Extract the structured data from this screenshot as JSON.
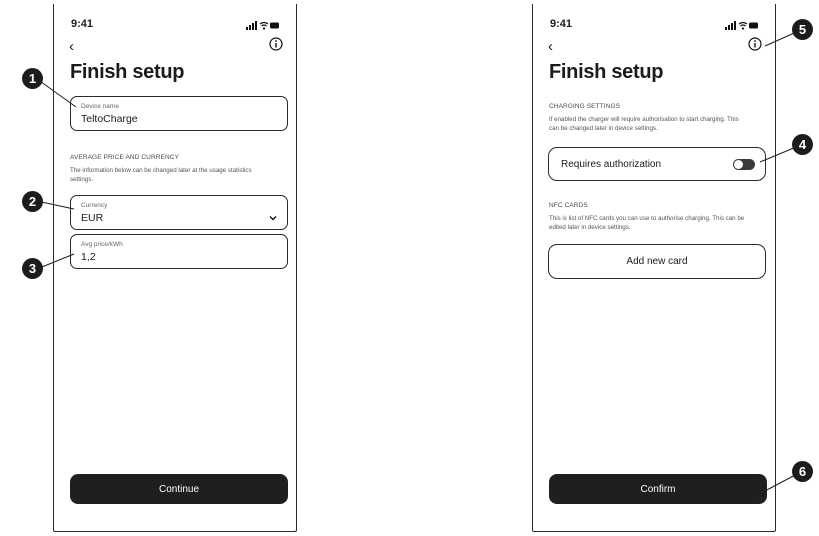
{
  "status": {
    "time": "9:41"
  },
  "screen1": {
    "title": "Finish setup",
    "device_name": {
      "label": "Device name",
      "value": "TeltoCharge"
    },
    "price_section": {
      "heading": "AVERAGE PRICE AND CURRENCY",
      "description": "The information below can be changed later at the usage statistics settings."
    },
    "currency": {
      "label": "Currency",
      "value": "EUR"
    },
    "avg_price": {
      "label": "Avg price/kWh",
      "value": "1,2"
    },
    "continue_label": "Continue"
  },
  "screen2": {
    "title": "Finish setup",
    "charging_section": {
      "heading": "CHARGING SETTINGS",
      "description": "If enabled the charger will require authorisation to start charging. This can be changed later in device settings."
    },
    "requires_auth": {
      "label": "Requires authorization",
      "enabled": false
    },
    "nfc_section": {
      "heading": "NFC CARDS",
      "description": "This is list of NFC cards you can use to authorise charging. This can be edited later in device settings."
    },
    "add_card_label": "Add new card",
    "confirm_label": "Confirm"
  },
  "callouts": [
    "1",
    "2",
    "3",
    "4",
    "5",
    "6"
  ],
  "icons": {
    "back": "chevron-left-icon",
    "info": "info-circle-icon",
    "dropdown": "chevron-down-icon",
    "signal": "signal-icon",
    "wifi": "wifi-icon",
    "battery": "battery-icon"
  }
}
